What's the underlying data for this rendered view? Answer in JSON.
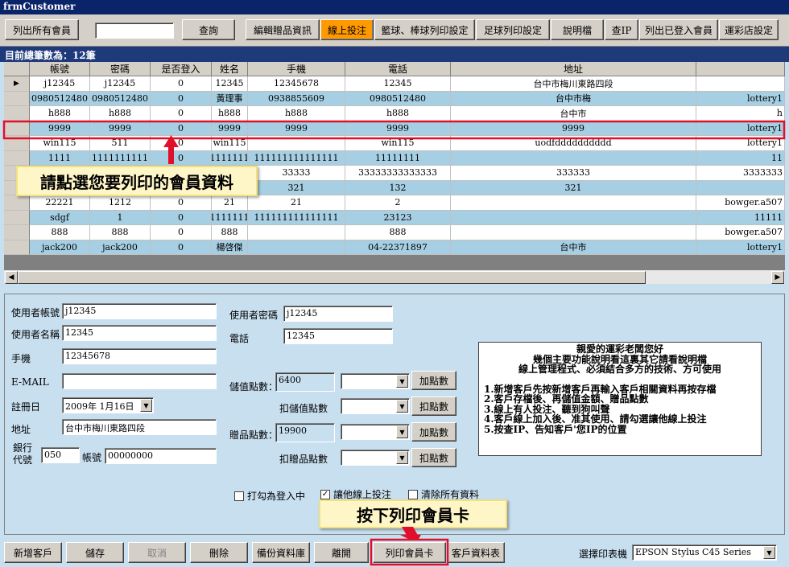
{
  "window": {
    "title": "frmCustomer"
  },
  "toolbar": {
    "list_all": "列出所有會員",
    "search_value": "",
    "query": "查詢",
    "edit_gift": "編輯贈品資訊",
    "online_bet": "線上投注",
    "basketball_print": "籃球、棒球列印設定",
    "football_print": "足球列印設定",
    "help": "說明檔",
    "check_ip": "查IP",
    "list_logged_in": "列出已登入會員",
    "shop_settings": "運彩店設定"
  },
  "grid": {
    "count_label": "目前總筆數為：12筆",
    "columns": [
      "帳號",
      "密碼",
      "是否登入",
      "姓名",
      "手機",
      "電話",
      "地址",
      ""
    ],
    "rows": [
      [
        "j12345",
        "j12345",
        "0",
        "12345",
        "12345678",
        "12345",
        "台中市梅川東路四段",
        ""
      ],
      [
        "0980512480",
        "0980512480",
        "0",
        "黃理事",
        "0938855609",
        "0980512480",
        "台中市梅",
        "lottery1"
      ],
      [
        "h888",
        "h888",
        "0",
        "h888",
        "h888",
        "h888",
        "台中市",
        "h"
      ],
      [
        "9999",
        "9999",
        "0",
        "9999",
        "9999",
        "9999",
        "9999",
        "lottery1"
      ],
      [
        "win115",
        "511",
        "0",
        "win115",
        "",
        "win115",
        "uodfdddddddddd",
        "lottery1"
      ],
      [
        "1111",
        "1111111111",
        "0",
        "1111111",
        "111111111111111",
        "11111111",
        "",
        "11"
      ],
      [
        "",
        "",
        "",
        "33333",
        "33333",
        "33333333333333",
        "333333",
        "3333333"
      ],
      [
        "",
        "",
        "",
        "",
        "321",
        "132",
        "321",
        ""
      ],
      [
        "22221",
        "1212",
        "0",
        "21",
        "21",
        "2",
        "",
        "bowger.a507"
      ],
      [
        "sdgf",
        "1",
        "0",
        "1111111",
        "111111111111111",
        "23123",
        "",
        "11111"
      ],
      [
        "888",
        "888",
        "0",
        "888",
        "",
        "888",
        "",
        "bowger.a507"
      ],
      [
        "jack200",
        "jack200",
        "0",
        "楊啓傑",
        "",
        "04-22371897",
        "台中市",
        "lottery1"
      ]
    ]
  },
  "form": {
    "username_label": "使用者帳號",
    "username": "j12345",
    "password_label": "使用者密碼",
    "password": "j12345",
    "name_label": "使用者名稱",
    "name": "12345",
    "phone_label": "電話",
    "phone": "12345",
    "mobile_label": "手機",
    "mobile": "12345678",
    "email_label": "E-MAIL",
    "email": "",
    "reg_date_label": "註冊日",
    "reg_date": "2009年 1月16日",
    "address_label": "地址",
    "address": "台中市梅川東路四段",
    "bank_label_1": "銀行",
    "bank_label_2": "代號",
    "bank_code": "050",
    "account_label": "帳號",
    "account": "00000000",
    "stored_points_label": "儲值點數：",
    "stored_points": "6400",
    "add_points": "加點數",
    "deduct_stored_label": "扣儲值點數",
    "deduct_points": "扣點數",
    "gift_points_label": "贈品點數：",
    "gift_points": "19900",
    "deduct_gift_label": "扣贈品點數"
  },
  "notice": {
    "lines": [
      "親愛的運彩老闆您好",
      "幾個主要功能說明看這裏其它請看說明檔",
      "線上管理程式、必須結合多方的技術、方可使用",
      "",
      "1.新增客戶先按新增客戶再輸入客戶相關資料再按存檔",
      "2.客戶存檔後、再儲值金額、贈品點數",
      "3.線上有人投注、聽到狗叫聲",
      "4.客戶線上加入後、准其使用、請勾選讓他線上投注",
      "5.按查IP、告知客戶'您IP的位置"
    ]
  },
  "checks": {
    "login": "打勾為登入中",
    "login_checked": false,
    "online": "讓他線上投注",
    "online_checked": true,
    "clear": "清除所有資料",
    "clear_checked": false
  },
  "bottom": {
    "new_customer": "新增客戶",
    "save": "儲存",
    "cancel": "取消",
    "delete": "刪除",
    "backup": "備份資料庫",
    "exit": "離開",
    "print_card": "列印會員卡",
    "customer_data": "客戶資料表",
    "printer_label": "選擇印表機",
    "printer": "EPSON Stylus C45 Series"
  },
  "annotations": {
    "select_member": "請點選您要列印的會員資料",
    "press_print": "按下列印會員卡"
  },
  "colors": {
    "highlight_red": "#e0102a",
    "online_orange": "#ff9900",
    "row_blue": "#a7cfe3"
  }
}
